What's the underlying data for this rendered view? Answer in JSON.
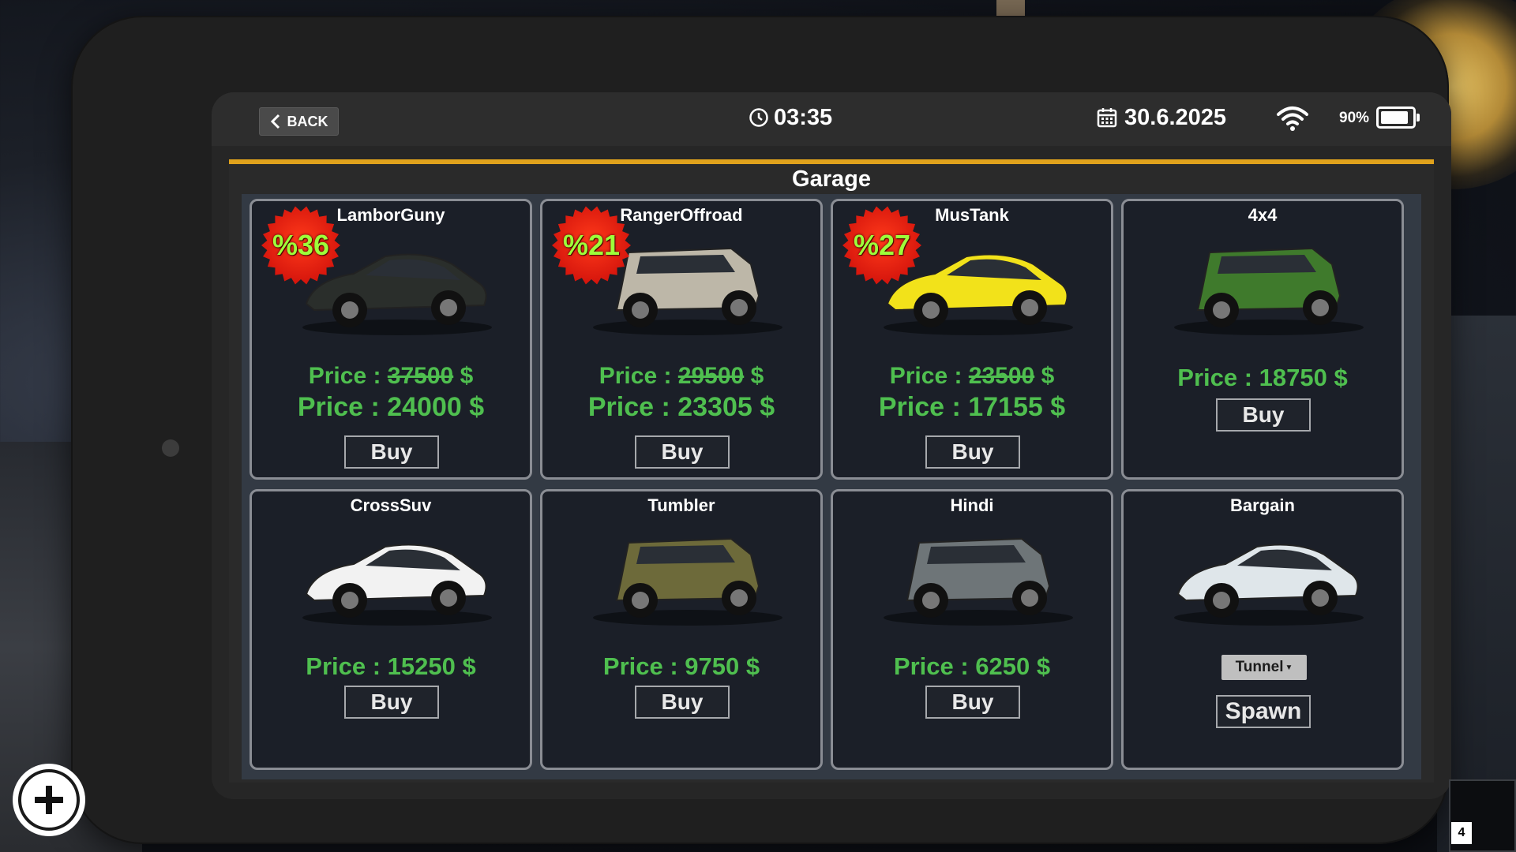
{
  "status_bar": {
    "back_label": "BACK",
    "time": "03:35",
    "date": "30.6.2025",
    "battery_percent_text": "90%",
    "battery_level": 0.9
  },
  "garage": {
    "title": "Garage",
    "price_prefix": "Price : ",
    "currency": " $",
    "buy_label": "Buy",
    "cars": [
      {
        "name": "LamborGuny",
        "discount": "%36",
        "old_price": "37500",
        "price": "24000",
        "body_color": "#2a2e2b",
        "icon": "sports-car-icon"
      },
      {
        "name": "RangerOffroad",
        "discount": "%21",
        "old_price": "29500",
        "price": "23305",
        "body_color": "#bdb7a8",
        "icon": "offroad-suv-icon"
      },
      {
        "name": "MusTank",
        "discount": "%27",
        "old_price": "23500",
        "price": "17155",
        "body_color": "#f2e21a",
        "icon": "muscle-car-icon"
      },
      {
        "name": "4x4",
        "price": "18750",
        "body_color": "#3f7a2c",
        "icon": "jeep-icon"
      },
      {
        "name": "CrossSuv",
        "price": "15250",
        "body_color": "#f2f2f2",
        "icon": "crossover-suv-icon"
      },
      {
        "name": "Tumbler",
        "price": "9750",
        "body_color": "#6d6a3a",
        "icon": "buggy-icon"
      },
      {
        "name": "Hindi",
        "price": "6250",
        "body_color": "#6e7578",
        "icon": "armored-vehicle-icon"
      }
    ],
    "owned_car": {
      "name": "Bargain",
      "body_color": "#dfe6ea",
      "icon": "hatchback-icon",
      "location_option": "Tunnel",
      "spawn_label": "Spawn"
    }
  },
  "colors": {
    "accent_bar": "#e0a21c",
    "price_green": "#4fbf4f",
    "discount_text": "#9dff3a",
    "discount_badge": "#d4140c"
  }
}
